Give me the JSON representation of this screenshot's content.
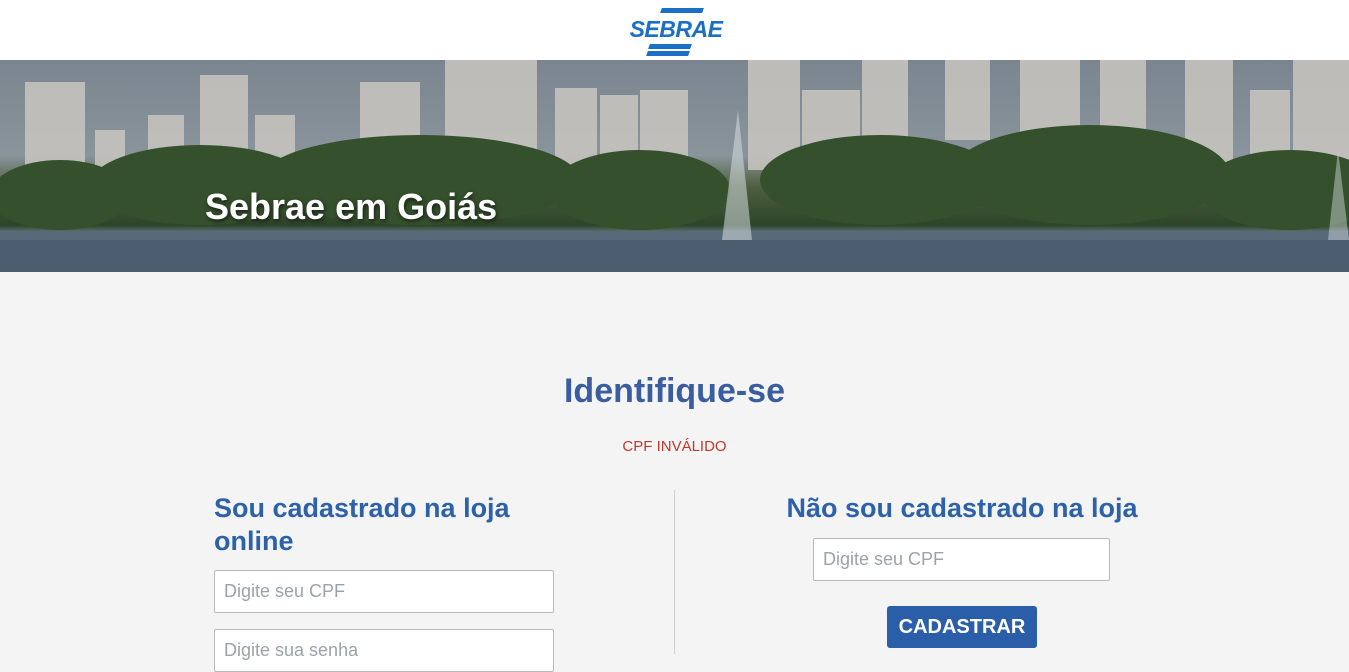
{
  "header": {
    "logo_text": "SEBRAE",
    "brand_color": "#1b6fc5"
  },
  "banner": {
    "title": "Sebrae em Goiás"
  },
  "main": {
    "headline": "Identifique-se",
    "error_message": "CPF INVÁLIDO",
    "registered": {
      "title": "Sou cadastrado na loja online",
      "cpf_placeholder": "Digite seu CPF",
      "password_placeholder": "Digite sua senha"
    },
    "not_registered": {
      "title": "Não sou cadastrado na loja",
      "cpf_placeholder": "Digite seu CPF",
      "button_label": "CADASTRAR"
    }
  },
  "colors": {
    "headline": "#3a5da0",
    "error": "#c0392b",
    "button": "#2b5ea8"
  }
}
